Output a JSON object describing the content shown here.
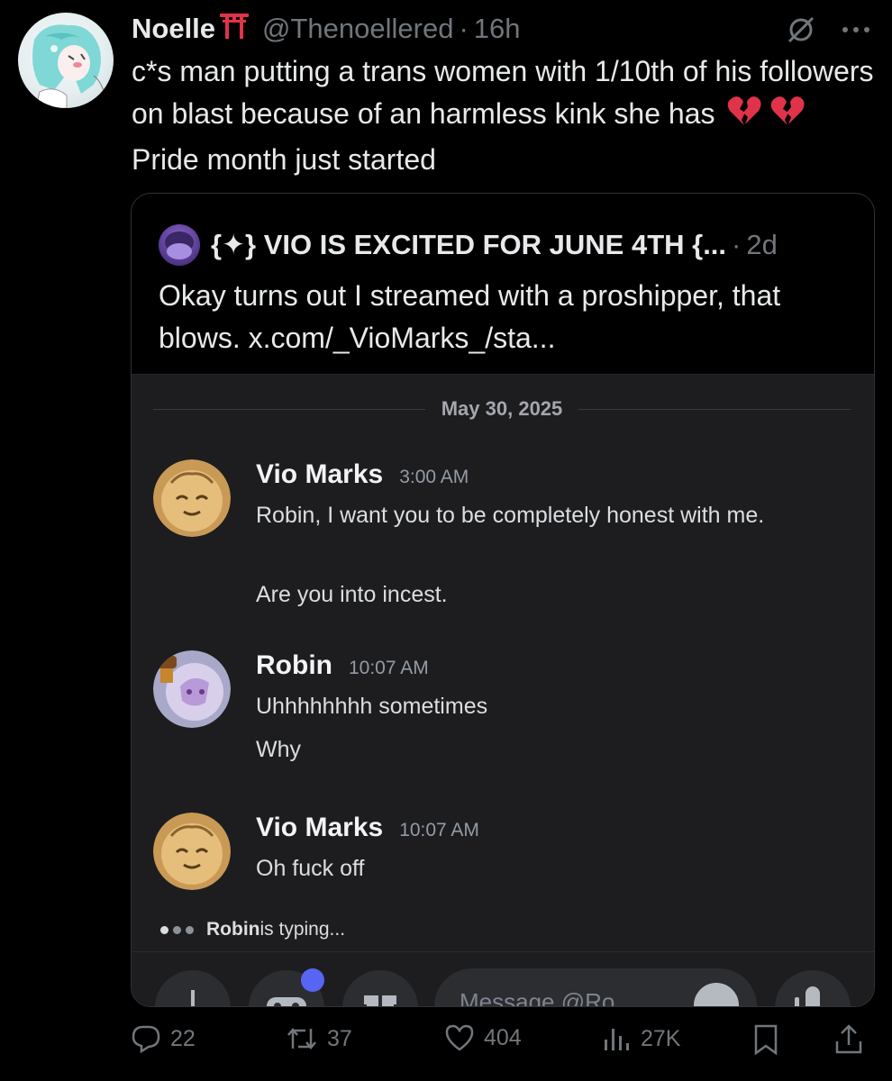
{
  "tweet": {
    "display_name": "Noelle",
    "handle": "@Thenoellered",
    "separator": "·",
    "time": "16h",
    "text_part1": "c*s man putting a trans women with 1/10th of his followers on blast because of an harmless kink she has",
    "text_part2": "Pride month just started",
    "icons": [
      "torii-gate-icon",
      "broken-heart-icon",
      "grok-icon",
      "more-icon"
    ]
  },
  "quote": {
    "name": "{✦} VIO IS EXCITED FOR JUNE 4TH {...",
    "separator": "·",
    "time": "2d",
    "text": "Okay turns out I streamed with a proshipper, that blows. x.com/_VioMarks_/sta..."
  },
  "discord": {
    "date": "May 30, 2025",
    "messages": [
      {
        "author": "Vio Marks",
        "time": "3:00 AM",
        "lines": [
          "Robin, I want you to be completely honest with me.",
          "",
          "Are you into incest."
        ]
      },
      {
        "author": "Robin",
        "time": "10:07 AM",
        "lines": [
          "Uhhhhhhhh sometimes",
          "Why"
        ]
      },
      {
        "author": "Vio Marks",
        "time": "10:07 AM",
        "lines": [
          "Oh fuck off"
        ]
      }
    ],
    "typing_author": "Robin",
    "typing_suffix": " is typing...",
    "input_placeholder": "Message @Ro"
  },
  "actions": {
    "replies": "22",
    "reposts": "37",
    "likes": "404",
    "views": "27K"
  },
  "colors": {
    "background": "#000000",
    "text": "#e7e9ea",
    "muted": "#71767b",
    "discord_bg": "#1d1d20",
    "discord_accent": "#5865f2",
    "broken_heart": "#e0334a"
  }
}
